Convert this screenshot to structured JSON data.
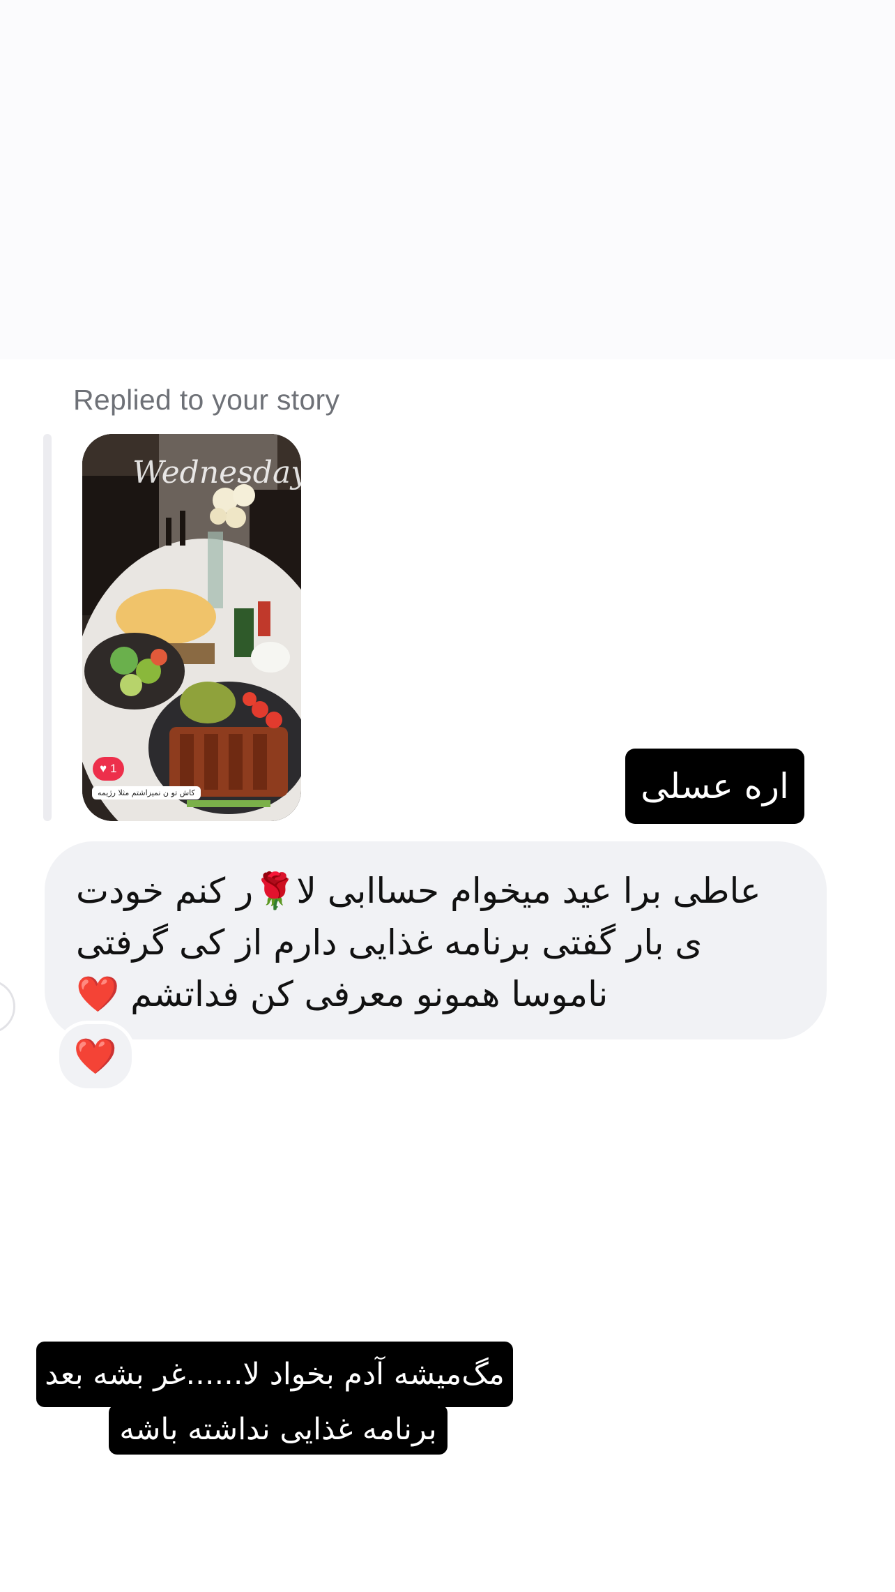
{
  "reply_header": {
    "label": "Replied to your story"
  },
  "story": {
    "overlay_text": "Wednesday",
    "like_count": "1",
    "caption": "کاش تو ن نمیزاشتم مثلا رژیمه"
  },
  "sent_message": {
    "text": "اره عسلی"
  },
  "received_message": {
    "lines": [
      "عاطی برا عید میخوام حساابی لا🌹ر کنم خودت",
      "ی بار گفتی برنامه غذایی دارم  از کی گرفتی",
      "ناموسا همونو معرفی کن فداتشم ❤️"
    ]
  },
  "reaction": {
    "emoji": "❤️"
  },
  "overlay_caption": {
    "line1": "مگ‌میشه آدم بخواد لا......غر بشه بعد",
    "line2": "برنامه غذایی نداشته باشه"
  },
  "colors": {
    "bubble_bg": "#f1f2f5",
    "sent_bubble_bg": "#000000",
    "muted_text": "#6e7177",
    "heart": "#e3121b",
    "like_badge": "#ed2f4b"
  },
  "icons": [
    "heart-icon",
    "rose-emoji",
    "avatar"
  ]
}
